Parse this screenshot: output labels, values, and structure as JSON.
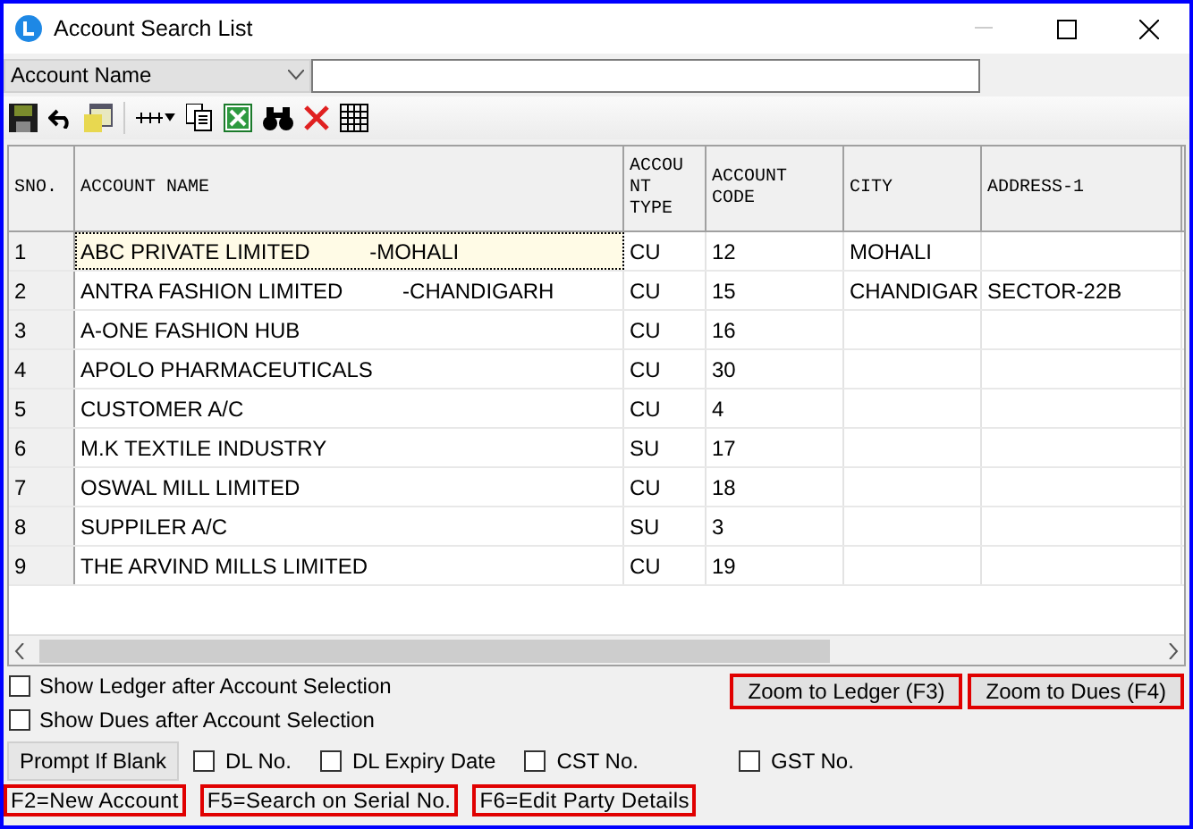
{
  "window": {
    "title": "Account Search List"
  },
  "search": {
    "field": "Account Name"
  },
  "table": {
    "columns": [
      "SNO.",
      "ACCOUNT NAME",
      "ACCOU NT TYPE",
      "ACCOUNT CODE",
      "CITY",
      "ADDRESS-1"
    ],
    "rows": [
      {
        "selected": true,
        "cells": [
          "1",
          "ABC PRIVATE LIMITED          -MOHALI",
          "CU",
          "12",
          "MOHALI",
          ""
        ]
      },
      {
        "selected": false,
        "cells": [
          "2",
          "ANTRA FASHION LIMITED          -CHANDIGARH",
          "CU",
          "15",
          "CHANDIGAR",
          "SECTOR-22B"
        ]
      },
      {
        "selected": false,
        "cells": [
          "3",
          "A-ONE FASHION HUB",
          "CU",
          "16",
          "",
          ""
        ]
      },
      {
        "selected": false,
        "cells": [
          "4",
          "APOLO PHARMACEUTICALS",
          "CU",
          "30",
          "",
          ""
        ]
      },
      {
        "selected": false,
        "cells": [
          "5",
          "CUSTOMER A/C",
          "CU",
          "4",
          "",
          ""
        ]
      },
      {
        "selected": false,
        "cells": [
          "6",
          "M.K TEXTILE INDUSTRY",
          "SU",
          "17",
          "",
          ""
        ]
      },
      {
        "selected": false,
        "cells": [
          "7",
          "OSWAL MILL LIMITED",
          "CU",
          "18",
          "",
          ""
        ]
      },
      {
        "selected": false,
        "cells": [
          "8",
          "SUPPILER A/C",
          "SU",
          "3",
          "",
          ""
        ]
      },
      {
        "selected": false,
        "cells": [
          "9",
          "THE ARVIND MILLS LIMITED",
          "CU",
          "19",
          "",
          ""
        ]
      }
    ]
  },
  "options": [
    {
      "label": "Show Ledger after Account Selection",
      "checked": false
    },
    {
      "label": "Show Dues after Account Selection",
      "checked": false
    }
  ],
  "buttons": [
    "Zoom to Ledger (F3)",
    "Zoom to Dues (F4)"
  ],
  "prompt": {
    "label": "Prompt If Blank",
    "fields": [
      {
        "label": "DL No.",
        "checked": false
      },
      {
        "label": "DL Expiry Date",
        "checked": false
      },
      {
        "label": "CST No.",
        "checked": false
      },
      {
        "label": "GST No.",
        "checked": false
      }
    ]
  },
  "status_bar": [
    "F2=New Account",
    "F5=Search on Serial No.",
    "F6=Edit Party Details"
  ]
}
